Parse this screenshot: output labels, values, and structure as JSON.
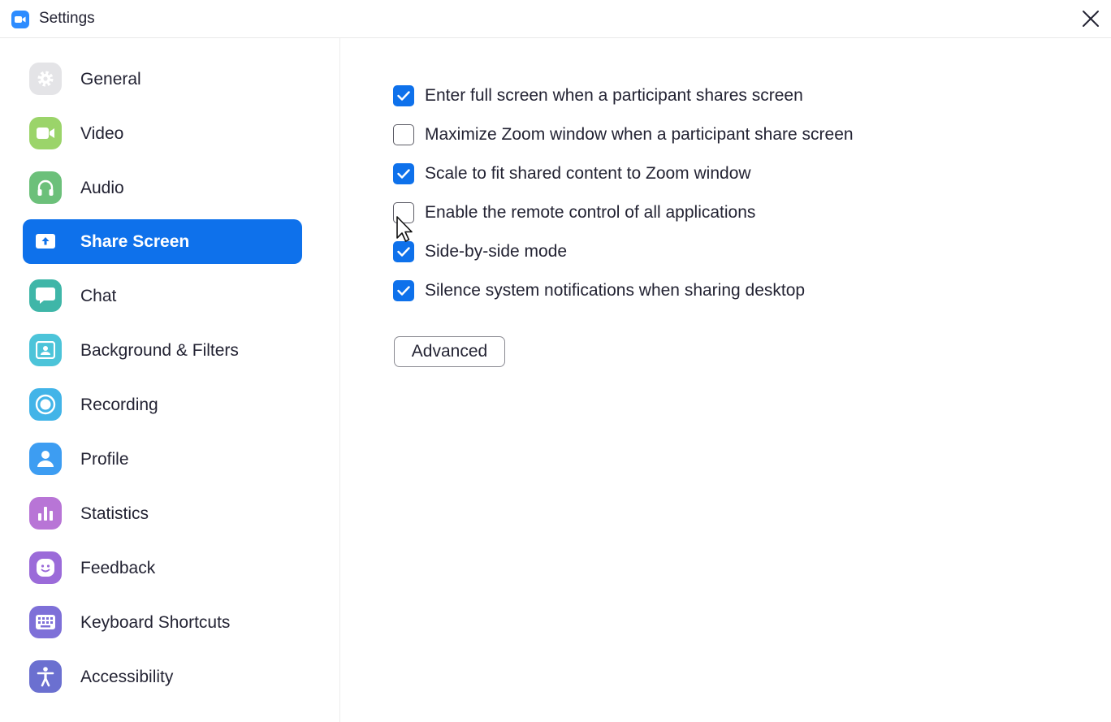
{
  "window": {
    "title": "Settings",
    "app_icon": "zoom-camera-icon",
    "close_icon": "close-icon"
  },
  "sidebar": {
    "items": [
      {
        "label": "General",
        "icon": "gear-icon",
        "color": "#e4e4e7",
        "active": false
      },
      {
        "label": "Video",
        "icon": "video-camera-icon",
        "color": "#9bd46a",
        "active": false
      },
      {
        "label": "Audio",
        "icon": "headphones-icon",
        "color": "#6cc07a",
        "active": false
      },
      {
        "label": "Share Screen",
        "icon": "share-screen-icon",
        "color": "#0e71eb",
        "active": true
      },
      {
        "label": "Chat",
        "icon": "chat-bubble-icon",
        "color": "#3fb6a8",
        "active": false
      },
      {
        "label": "Background & Filters",
        "icon": "background-person-icon",
        "color": "#4cc4d9",
        "active": false
      },
      {
        "label": "Recording",
        "icon": "record-icon",
        "color": "#42b4e8",
        "active": false
      },
      {
        "label": "Profile",
        "icon": "profile-icon",
        "color": "#3d9df2",
        "active": false
      },
      {
        "label": "Statistics",
        "icon": "bar-chart-icon",
        "color": "#b875d6",
        "active": false
      },
      {
        "label": "Feedback",
        "icon": "smiley-icon",
        "color": "#9b6bd9",
        "active": false
      },
      {
        "label": "Keyboard Shortcuts",
        "icon": "keyboard-icon",
        "color": "#7e70d8",
        "active": false
      },
      {
        "label": "Accessibility",
        "icon": "accessibility-icon",
        "color": "#6b70d0",
        "active": false
      }
    ]
  },
  "share_screen": {
    "options": [
      {
        "label": "Enter full screen when a participant shares screen",
        "checked": true
      },
      {
        "label": "Maximize Zoom window when a participant share screen",
        "checked": false
      },
      {
        "label": "Scale to fit shared content to Zoom window",
        "checked": true
      },
      {
        "label": "Enable the remote control of all applications",
        "checked": false
      },
      {
        "label": "Side-by-side mode",
        "checked": true
      },
      {
        "label": "Silence system notifications when sharing desktop",
        "checked": true
      }
    ],
    "advanced_label": "Advanced"
  },
  "colors": {
    "accent": "#0e71eb",
    "text": "#232333"
  }
}
